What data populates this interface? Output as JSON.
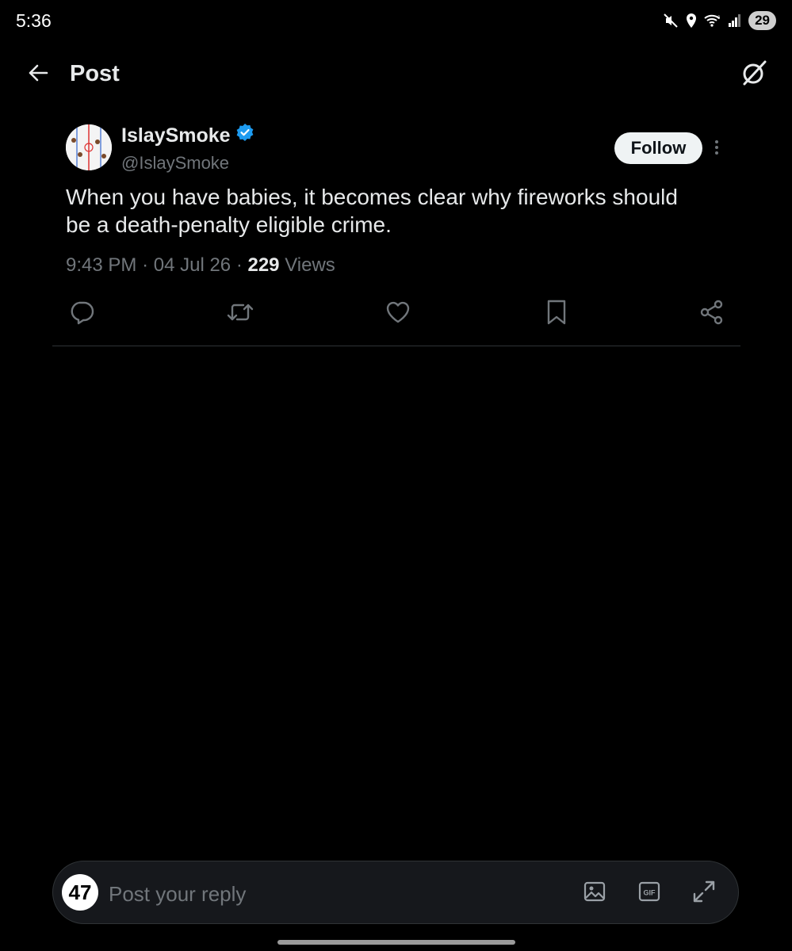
{
  "status_bar": {
    "time": "5:36",
    "battery": "29",
    "icons": [
      "mute-icon",
      "location-icon",
      "wifi-icon",
      "signal-icon",
      "battery-icon"
    ]
  },
  "header": {
    "title": "Post",
    "back_icon": "arrow-left-icon",
    "grok_icon": "grok-icon"
  },
  "post": {
    "author_name": "IslaySmoke",
    "author_handle": "@IslaySmoke",
    "verified": true,
    "follow_label": "Follow",
    "text": "When you have babies, it becomes clear why fireworks should be a death-penalty eligible crime.",
    "time": "9:43 PM",
    "date": "04 Jul 26",
    "separator": "·",
    "views_count": "229",
    "views_label": "Views",
    "actions": [
      "reply-icon",
      "repost-icon",
      "like-icon",
      "bookmark-icon",
      "share-icon"
    ]
  },
  "reply_bar": {
    "avatar_text": "47",
    "placeholder": "Post your reply",
    "tools": [
      "image-icon",
      "gif-icon",
      "expand-icon"
    ]
  },
  "colors": {
    "background": "#000000",
    "text_primary": "#e7e9ea",
    "text_secondary": "#71767b",
    "verified": "#1d9bf0",
    "divider": "#2f3336"
  }
}
